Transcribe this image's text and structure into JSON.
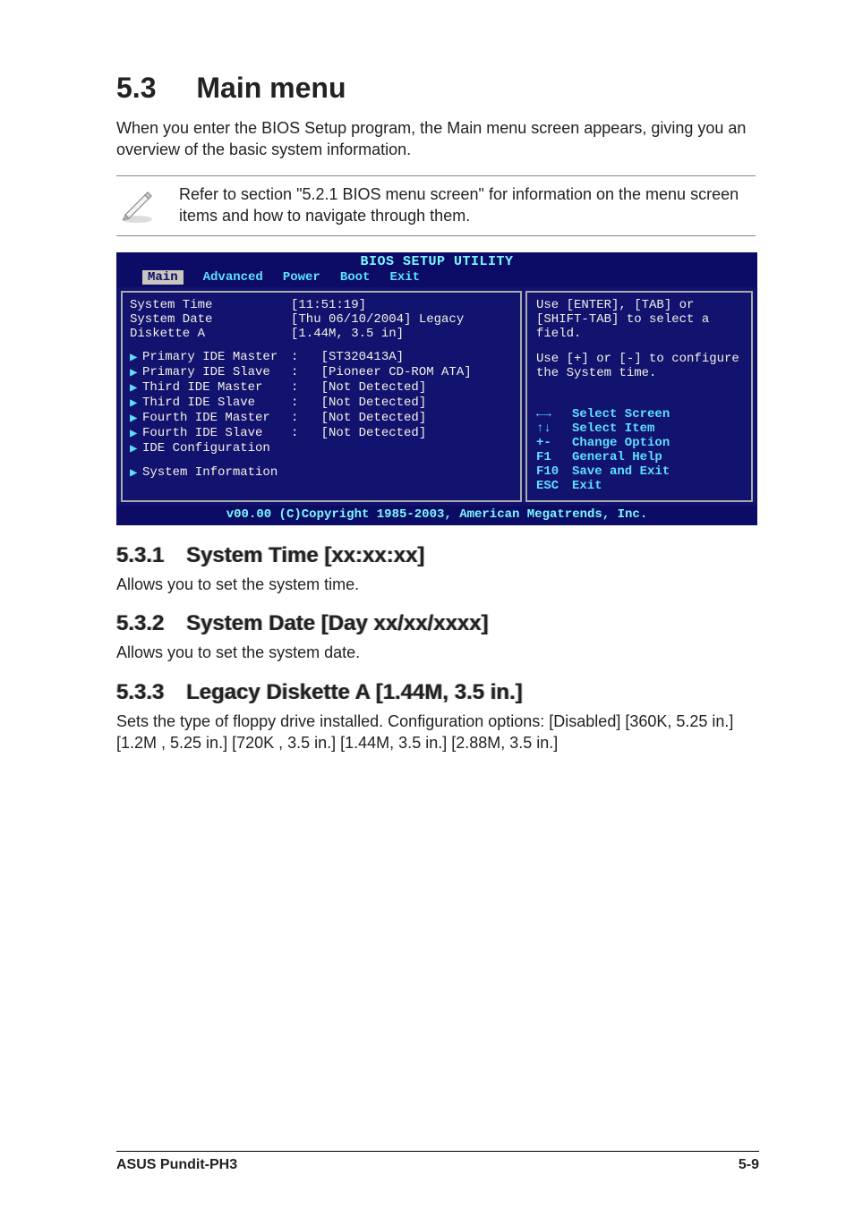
{
  "heading": {
    "number": "5.3",
    "title": "Main menu"
  },
  "intro": "When you enter the BIOS Setup program, the Main menu screen appears, giving you an overview of the basic system information.",
  "note": "Refer to section \"5.2.1 BIOS menu screen\" for information on the menu screen items and how to navigate through them.",
  "bios": {
    "title": "BIOS SETUP UTILITY",
    "menubar": {
      "selected": "Main",
      "items": [
        "Advanced",
        "Power",
        "Boot",
        "Exit"
      ]
    },
    "main_rows": [
      {
        "label": "System Time",
        "value": "[11:51:19]"
      },
      {
        "label": "System Date",
        "value": "[Thu 06/10/2004] Legacy"
      },
      {
        "label": "Diskette A",
        "value": "[1.44M, 3.5 in]"
      }
    ],
    "submenus1": [
      {
        "label": "Primary IDE Master",
        "value": "[ST320413A]"
      },
      {
        "label": "Primary IDE Slave",
        "value": "[Pioneer CD-ROM ATA]"
      },
      {
        "label": "Third IDE Master",
        "value": "[Not Detected]"
      },
      {
        "label": "Third IDE Slave",
        "value": "[Not Detected]"
      },
      {
        "label": "Fourth IDE Master",
        "value": "[Not Detected]"
      },
      {
        "label": "Fourth IDE Slave",
        "value": "[Not Detected]"
      },
      {
        "label": "IDE Configuration",
        "value": ""
      }
    ],
    "submenus2": [
      {
        "label": "System Information",
        "value": ""
      }
    ],
    "help1": "Use [ENTER], [TAB] or [SHIFT-TAB] to select a field.",
    "help2": "Use [+] or [-] to configure the System time.",
    "keymap": [
      {
        "key": "←→",
        "desc": "Select Screen"
      },
      {
        "key": "↑↓",
        "desc": "Select Item"
      },
      {
        "key": "+-",
        "desc": "Change Option"
      },
      {
        "key": "F1",
        "desc": "General Help"
      },
      {
        "key": "F10",
        "desc": "Save and Exit"
      },
      {
        "key": "ESC",
        "desc": "Exit"
      }
    ],
    "footer": "v00.00 (C)Copyright 1985-2003, American Megatrends, Inc."
  },
  "sections": [
    {
      "num": "5.3.1",
      "title": "System Time [xx:xx:xx]",
      "body": "Allows you to set the system time."
    },
    {
      "num": "5.3.2",
      "title": "System Date [Day xx/xx/xxxx]",
      "body": "Allows you to set the system date."
    },
    {
      "num": "5.3.3",
      "title": "Legacy Diskette A [1.44M, 3.5 in.]",
      "body": "Sets the type of floppy drive installed. Configuration options: [Disabled] [360K, 5.25 in.] [1.2M , 5.25 in.] [720K , 3.5 in.] [1.44M, 3.5 in.] [2.88M, 3.5 in.]"
    }
  ],
  "footer": {
    "left": "ASUS Pundit-PH3",
    "right": "5-9"
  }
}
